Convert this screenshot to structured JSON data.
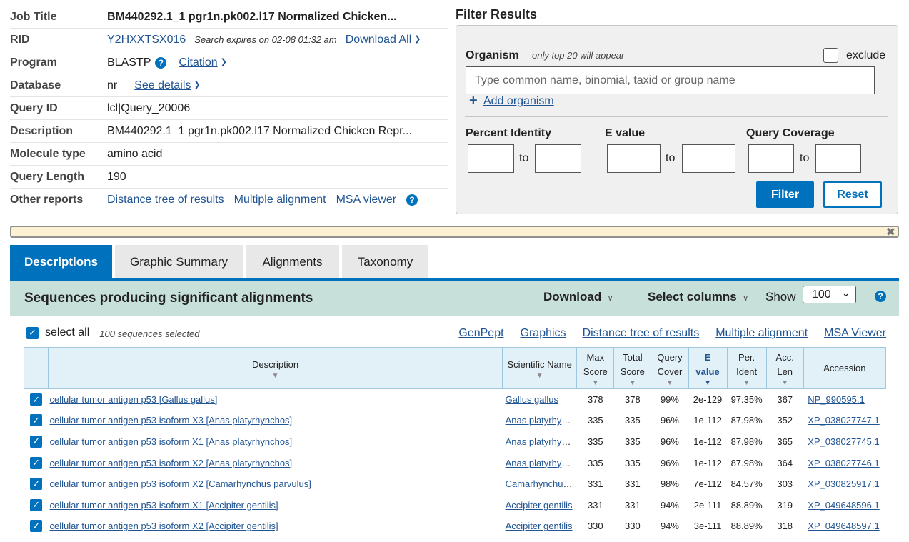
{
  "job": {
    "rows": {
      "job_title": {
        "label": "Job Title",
        "value": "BM440292.1_1 pgr1n.pk002.l17 Normalized Chicken..."
      },
      "rid": {
        "label": "RID",
        "value": "Y2HXXTSX016",
        "expires": "Search expires on 02-08 01:32 am",
        "download_all": "Download All"
      },
      "program": {
        "label": "Program",
        "value": "BLASTP",
        "citation": "Citation"
      },
      "database": {
        "label": "Database",
        "value": "nr",
        "see_details": "See details"
      },
      "query_id": {
        "label": "Query ID",
        "value": "lcl|Query_20006"
      },
      "description": {
        "label": "Description",
        "value": "BM440292.1_1 pgr1n.pk002.l17 Normalized Chicken Repr..."
      },
      "molecule_type": {
        "label": "Molecule type",
        "value": "amino acid"
      },
      "query_length": {
        "label": "Query Length",
        "value": "190"
      },
      "other_reports": {
        "label": "Other reports",
        "distance_tree": "Distance tree of results",
        "multiple_alignment": "Multiple alignment",
        "msa_viewer": "MSA viewer"
      }
    }
  },
  "filter": {
    "title": "Filter Results",
    "organism_label": "Organism",
    "organism_note": "only top 20 will appear",
    "exclude_label": "exclude",
    "organism_placeholder": "Type common  name, binomial, taxid or group  name",
    "add_organism": "Add organism",
    "percent_identity_label": "Percent Identity",
    "evalue_label": "E value",
    "query_coverage_label": "Query Coverage",
    "to_label": "to",
    "filter_button": "Filter",
    "reset_button": "Reset"
  },
  "tabs": [
    {
      "label": "Descriptions",
      "active": true
    },
    {
      "label": "Graphic Summary",
      "active": false
    },
    {
      "label": "Alignments",
      "active": false
    },
    {
      "label": "Taxonomy",
      "active": false
    }
  ],
  "results": {
    "title": "Sequences producing significant alignments",
    "download": "Download",
    "select_columns": "Select columns",
    "show_label": "Show",
    "show_value": "100",
    "select_all_label": "select all",
    "selected_count": "100 sequences selected",
    "action_links": [
      "GenPept",
      "Graphics",
      "Distance tree of results",
      "Multiple alignment",
      "MSA Viewer"
    ]
  },
  "table": {
    "headers": {
      "description": "Description",
      "scientific_name": "Scientific Name",
      "max_score": [
        "Max",
        "Score"
      ],
      "total_score": [
        "Total",
        "Score"
      ],
      "query_cover": [
        "Query",
        "Cover"
      ],
      "e_value": [
        "E",
        "value"
      ],
      "per_ident": [
        "Per.",
        "Ident"
      ],
      "acc_len": [
        "Acc.",
        "Len"
      ],
      "accession": "Accession"
    },
    "rows": [
      {
        "description": "cellular tumor antigen p53 [Gallus gallus]",
        "scientific_name": "Gallus gallus",
        "max_score": "378",
        "total_score": "378",
        "query_cover": "99%",
        "e_value": "2e-129",
        "per_ident": "97.35%",
        "acc_len": "367",
        "accession": "NP_990595.1"
      },
      {
        "description": "cellular tumor antigen p53 isoform X3 [Anas platyrhynchos]",
        "scientific_name": "Anas platyrhyn...",
        "max_score": "335",
        "total_score": "335",
        "query_cover": "96%",
        "e_value": "1e-112",
        "per_ident": "87.98%",
        "acc_len": "352",
        "accession": "XP_038027747.1"
      },
      {
        "description": "cellular tumor antigen p53 isoform X1 [Anas platyrhynchos]",
        "scientific_name": "Anas platyrhyn...",
        "max_score": "335",
        "total_score": "335",
        "query_cover": "96%",
        "e_value": "1e-112",
        "per_ident": "87.98%",
        "acc_len": "365",
        "accession": "XP_038027745.1"
      },
      {
        "description": "cellular tumor antigen p53 isoform X2 [Anas platyrhynchos]",
        "scientific_name": "Anas platyrhyn...",
        "max_score": "335",
        "total_score": "335",
        "query_cover": "96%",
        "e_value": "1e-112",
        "per_ident": "87.98%",
        "acc_len": "364",
        "accession": "XP_038027746.1"
      },
      {
        "description": "cellular tumor antigen p53 isoform X2 [Camarhynchus parvulus]",
        "scientific_name": "Camarhynchus...",
        "max_score": "331",
        "total_score": "331",
        "query_cover": "98%",
        "e_value": "7e-112",
        "per_ident": "84.57%",
        "acc_len": "303",
        "accession": "XP_030825917.1"
      },
      {
        "description": "cellular tumor antigen p53 isoform X1 [Accipiter gentilis]",
        "scientific_name": "Accipiter gentilis",
        "max_score": "331",
        "total_score": "331",
        "query_cover": "94%",
        "e_value": "2e-111",
        "per_ident": "88.89%",
        "acc_len": "319",
        "accession": "XP_049648596.1"
      },
      {
        "description": "cellular tumor antigen p53 isoform X2 [Accipiter gentilis]",
        "scientific_name": "Accipiter gentilis",
        "max_score": "330",
        "total_score": "330",
        "query_cover": "94%",
        "e_value": "3e-111",
        "per_ident": "88.89%",
        "acc_len": "318",
        "accession": "XP_049648597.1"
      }
    ]
  },
  "colors": {
    "primary": "#0071bc",
    "link": "#205493",
    "results_header_bg": "#c8e0da",
    "notice_bg": "#fcf2d3",
    "table_header_bg": "#e2f0f8"
  },
  "icons": {
    "help": "question-circle-icon",
    "chevron": "chevron-down-icon",
    "plus": "plus-icon",
    "close": "close-icon",
    "checkbox": "checkbox-checked-icon"
  }
}
